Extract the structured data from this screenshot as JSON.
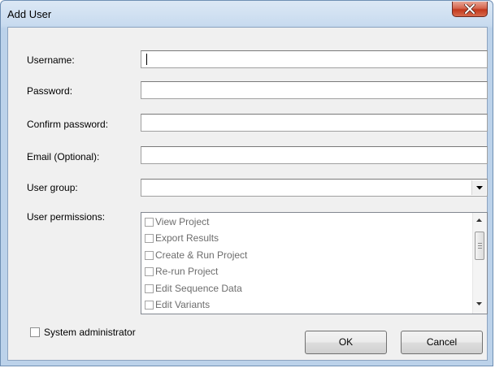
{
  "window": {
    "title": "Add User",
    "close_icon": "close-icon"
  },
  "form": {
    "username_label": "Username:",
    "username_value": "",
    "password_label": "Password:",
    "password_value": "",
    "confirm_password_label": "Confirm password:",
    "confirm_password_value": "",
    "email_label": "Email (Optional):",
    "email_value": "",
    "user_group_label": "User group:",
    "user_group_value": "",
    "permissions_label": "User permissions:",
    "permissions": [
      {
        "label": "View Project",
        "checked": false
      },
      {
        "label": "Export Results",
        "checked": false
      },
      {
        "label": "Create & Run Project",
        "checked": false
      },
      {
        "label": "Re-run Project",
        "checked": false
      },
      {
        "label": "Edit Sequence Data",
        "checked": false
      },
      {
        "label": "Edit Variants",
        "checked": false
      }
    ],
    "system_admin_label": "System administrator",
    "system_admin_checked": false
  },
  "buttons": {
    "ok_label": "OK",
    "cancel_label": "Cancel"
  }
}
